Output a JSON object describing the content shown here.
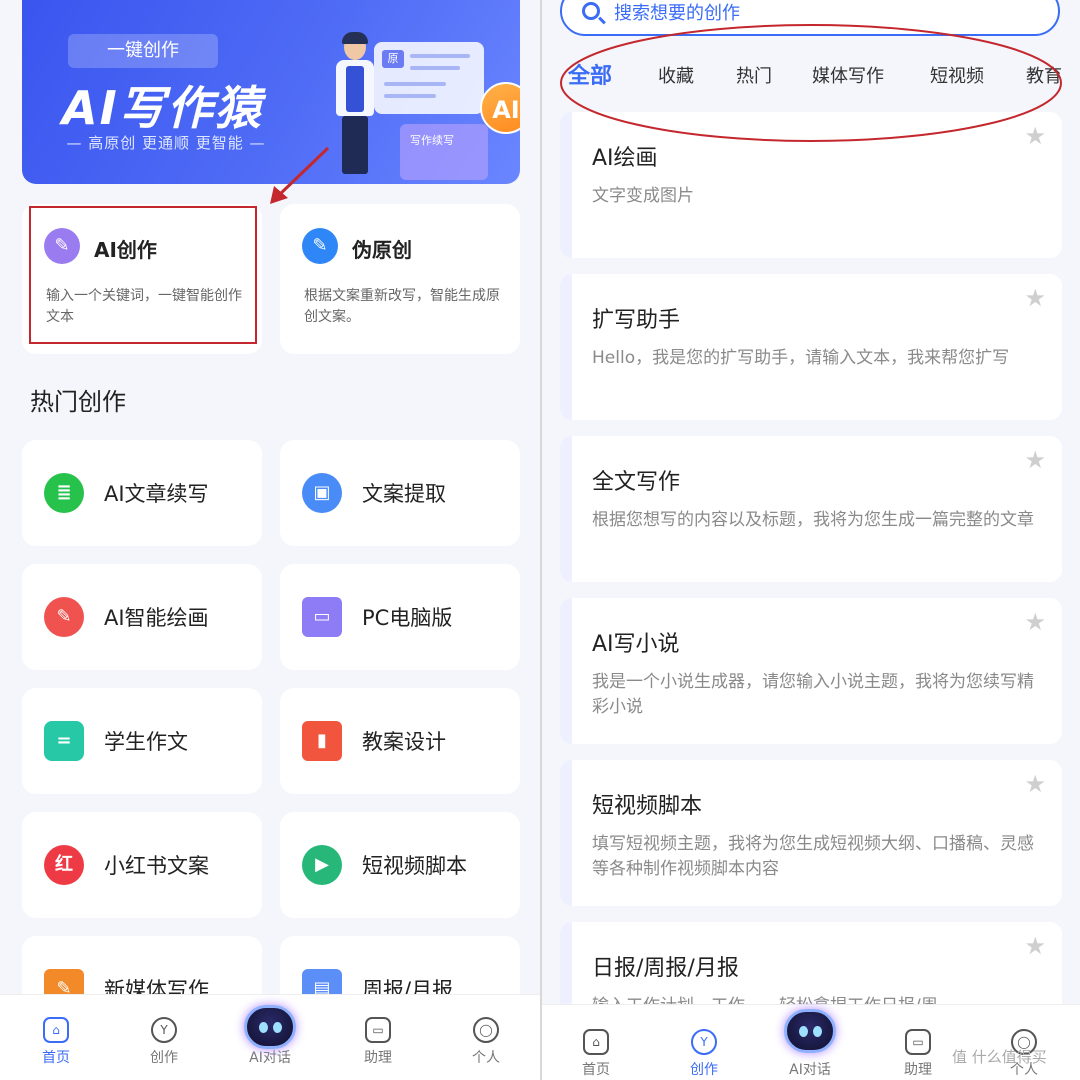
{
  "left": {
    "banner": {
      "tag": "一键创作",
      "title": "AI写作猿",
      "subtitle": "— 高原创  更通顺  更智能 —",
      "art_card_label": "原",
      "art_card2_text": "写作续写",
      "art_badge": "AI"
    },
    "top_cards": [
      {
        "title": "AI创作",
        "desc": "输入一个关键词，一键智能创作文本",
        "icon": "pen-icon",
        "color": "#9b7cf0"
      },
      {
        "title": "伪原创",
        "desc": "根据文案重新改写，智能生成原创文案。",
        "icon": "edit-icon",
        "color": "#2f86f6"
      }
    ],
    "section_title": "热门创作",
    "tools": [
      {
        "label": "AI文章续写",
        "icon": "document-icon",
        "glyph": "≣",
        "color": "#27c24c"
      },
      {
        "label": "文案提取",
        "icon": "video-extract-icon",
        "glyph": "▣",
        "color": "#4a8cf7"
      },
      {
        "label": "AI智能绘画",
        "icon": "palette-icon",
        "glyph": "✎",
        "color": "#f0524f"
      },
      {
        "label": "PC电脑版",
        "icon": "laptop-icon",
        "glyph": "▭",
        "color": "#8e7cf6"
      },
      {
        "label": "学生作文",
        "icon": "note-icon",
        "glyph": "=",
        "color": "#27c8a6"
      },
      {
        "label": "教案设计",
        "icon": "bookmark-icon",
        "glyph": "▮",
        "color": "#f2553e"
      },
      {
        "label": "小红书文案",
        "icon": "xiaohongshu-icon",
        "glyph": "红",
        "color": "#ee3a45"
      },
      {
        "label": "短视频脚本",
        "icon": "video-camera-icon",
        "glyph": "▶",
        "color": "#27b879"
      },
      {
        "label": "新媒体写作",
        "icon": "media-write-icon",
        "glyph": "✎",
        "color": "#f28a2a"
      },
      {
        "label": "周报/月报",
        "icon": "report-icon",
        "glyph": "▤",
        "color": "#5b8ef7"
      }
    ],
    "nav": [
      {
        "label": "首页",
        "icon": "home-icon",
        "glyph": "⌂"
      },
      {
        "label": "创作",
        "icon": "create-icon",
        "glyph": "Y"
      },
      {
        "label": "AI对话",
        "icon": "robot-icon",
        "glyph": ""
      },
      {
        "label": "助理",
        "icon": "assistant-icon",
        "glyph": "▭"
      },
      {
        "label": "个人",
        "icon": "profile-icon",
        "glyph": "◯"
      }
    ]
  },
  "right": {
    "search_placeholder": "搜索想要的创作",
    "tabs": [
      "全部",
      "收藏",
      "热门",
      "媒体写作",
      "短视频",
      "教育"
    ],
    "items": [
      {
        "title": "AI绘画",
        "desc": "文字变成图片"
      },
      {
        "title": "扩写助手",
        "desc": "Hello，我是您的扩写助手，请输入文本，我来帮您扩写"
      },
      {
        "title": "全文写作",
        "desc": "根据您想写的内容以及标题，我将为您生成一篇完整的文章"
      },
      {
        "title": "AI写小说",
        "desc": "我是一个小说生成器，请您输入小说主题，我将为您续写精彩小说"
      },
      {
        "title": "短视频脚本",
        "desc": "填写短视频主题，我将为您生成短视频大纲、口播稿、灵感等各种制作视频脚本内容"
      },
      {
        "title": "日报/周报/月报",
        "desc": "输入工作计划、工作……轻松拿捏工作日报/周"
      }
    ],
    "nav": [
      {
        "label": "首页",
        "icon": "home-icon",
        "glyph": "⌂"
      },
      {
        "label": "创作",
        "icon": "create-icon",
        "glyph": "Y"
      },
      {
        "label": "AI对话",
        "icon": "robot-icon",
        "glyph": ""
      },
      {
        "label": "助理",
        "icon": "assistant-icon",
        "glyph": "▭"
      },
      {
        "label": "个人",
        "icon": "profile-icon",
        "glyph": "◯"
      }
    ],
    "watermark": "值 什么值得买"
  }
}
